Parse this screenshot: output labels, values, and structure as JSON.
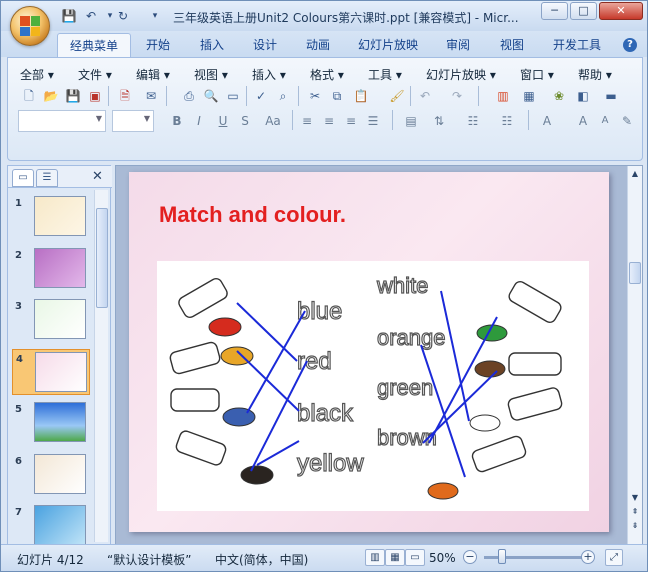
{
  "window": {
    "title": "三年级英语上册Unit2 Colours第六课时.ppt [兼容模式] - Micr...",
    "minimize_glyph": "─",
    "maximize_glyph": "□",
    "close_glyph": "✕"
  },
  "ribbon_tabs": [
    "经典菜单",
    "开始",
    "插入",
    "设计",
    "动画",
    "幻灯片放映",
    "审阅",
    "视图",
    "开发工具"
  ],
  "classic_menu": [
    "全部",
    "文件",
    "编辑",
    "视图",
    "插入",
    "格式",
    "工具",
    "幻灯片放映",
    "窗口",
    "帮助"
  ],
  "panel": {
    "slides": [
      {
        "number": "1"
      },
      {
        "number": "2"
      },
      {
        "number": "3"
      },
      {
        "number": "4",
        "selected": true
      },
      {
        "number": "5"
      },
      {
        "number": "6"
      },
      {
        "number": "7"
      }
    ]
  },
  "slide": {
    "title": "Match and colour.",
    "color_words_left": [
      "blue",
      "red",
      "black",
      "yellow"
    ],
    "color_words_right": [
      "white",
      "orange",
      "green",
      "brown"
    ],
    "paint_colors_left": [
      "#d52b1e",
      "#e8a628",
      "#3a5fb0",
      "#2a2420"
    ],
    "paint_colors_right": [
      "#2e9a3c",
      "#6b4225",
      "#ffffff",
      "#e06a1c"
    ],
    "line_color": "#1b2ad8"
  },
  "status": {
    "slide_indicator": "幻灯片 4/12",
    "theme": "“默认设计模板”",
    "language": "中文(简体，中国)",
    "zoom": "50%",
    "zoom_value": 0.5
  },
  "colors": {
    "title_red": "#e32020",
    "ribbon_tab_text": "#15428b",
    "selected_slide": "#f9c774"
  },
  "icons": [
    "office-button-icon",
    "save-icon",
    "undo-icon",
    "redo-icon",
    "help-icon",
    "close-icon",
    "fit-window-icon"
  ]
}
